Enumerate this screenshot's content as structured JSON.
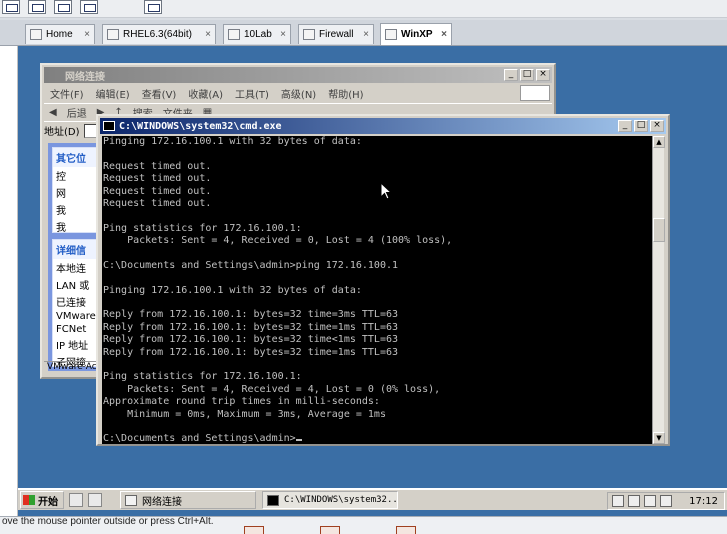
{
  "host": {
    "tabs": [
      {
        "label": "Home",
        "active": false
      },
      {
        "label": "RHEL6.3(64bit)",
        "active": false
      },
      {
        "label": "10Lab",
        "active": false
      },
      {
        "label": "Firewall",
        "active": false
      },
      {
        "label": "WinXP",
        "active": true
      }
    ],
    "tab_close": "×",
    "status_text": "ove the mouse pointer outside or press Ctrl+Alt."
  },
  "netwin": {
    "title": "网络连接",
    "menu": [
      "文件(F)",
      "编辑(E)",
      "查看(V)",
      "收藏(A)",
      "工具(T)",
      "高级(N)",
      "帮助(H)"
    ],
    "toolbar": [
      "后退",
      "搜索",
      "文件夹"
    ],
    "address_label": "地址(D)",
    "panel1": {
      "header": "其它位",
      "items": [
        "控",
        "网",
        "我",
        "我"
      ]
    },
    "panel2": {
      "header": "详细信",
      "items": [
        "本地连",
        "LAN 或",
        "已连接",
        "VMware",
        "FCNet",
        "IP 地址",
        "子网掩"
      ]
    },
    "status": "VMware Acc"
  },
  "cmdwin": {
    "title": "C:\\WINDOWS\\system32\\cmd.exe",
    "lines": [
      "Pinging 172.16.100.1 with 32 bytes of data:",
      "",
      "Request timed out.",
      "Request timed out.",
      "Request timed out.",
      "Request timed out.",
      "",
      "Ping statistics for 172.16.100.1:",
      "    Packets: Sent = 4, Received = 0, Lost = 4 (100% loss),",
      "",
      "C:\\Documents and Settings\\admin>ping 172.16.100.1",
      "",
      "Pinging 172.16.100.1 with 32 bytes of data:",
      "",
      "Reply from 172.16.100.1: bytes=32 time=3ms TTL=63",
      "Reply from 172.16.100.1: bytes=32 time=1ms TTL=63",
      "Reply from 172.16.100.1: bytes=32 time<1ms TTL=63",
      "Reply from 172.16.100.1: bytes=32 time=1ms TTL=63",
      "",
      "Ping statistics for 172.16.100.1:",
      "    Packets: Sent = 4, Received = 4, Lost = 0 (0% loss),",
      "Approximate round trip times in milli-seconds:",
      "    Minimum = 0ms, Maximum = 3ms, Average = 1ms",
      "",
      "C:\\Documents and Settings\\admin>"
    ]
  },
  "taskbar": {
    "start_label": "开始",
    "tasks": [
      {
        "label": "网络连接",
        "pressed": false
      },
      {
        "label": "C:\\WINDOWS\\system32...",
        "pressed": true
      }
    ],
    "clock": "17:12"
  }
}
